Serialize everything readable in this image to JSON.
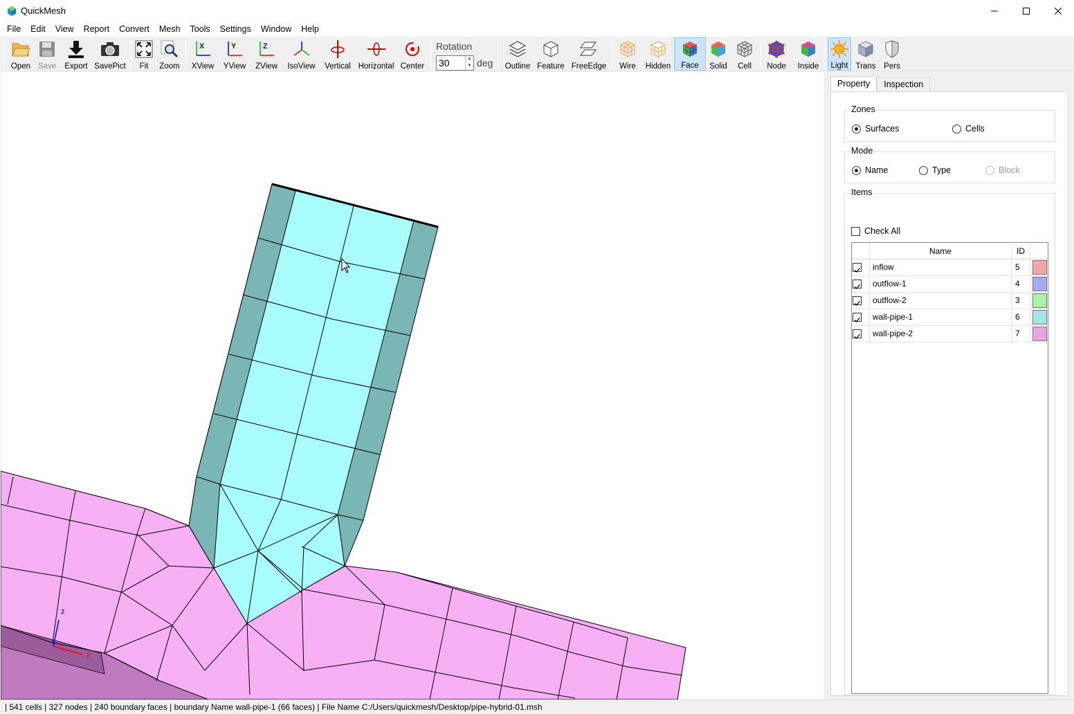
{
  "window": {
    "title": "QuickMesh"
  },
  "menu": [
    "File",
    "Edit",
    "View",
    "Report",
    "Convert",
    "Mesh",
    "Tools",
    "Settings",
    "Window",
    "Help"
  ],
  "toolbar": {
    "open": "Open",
    "save": "Save",
    "export": "Export",
    "savepict": "SavePict",
    "fit": "Fit",
    "zoom": "Zoom",
    "xview": "XView",
    "yview": "YView",
    "zview": "ZView",
    "isoview": "IsoView",
    "vertical": "Vertical",
    "horizontal": "Horizontal",
    "center": "Center",
    "rotation_label": "Rotation",
    "rotation_value": "30",
    "rotation_unit": "deg",
    "outline": "Outline",
    "feature": "Feature",
    "freeedge": "FreeEdge",
    "wire": "Wire",
    "hidden": "Hidden",
    "face": "Face",
    "solid": "Solid",
    "cell": "Cell",
    "node": "Node",
    "inside": "Inside",
    "light": "Light",
    "trans": "Trans",
    "pers": "Pers"
  },
  "panel": {
    "tabs": [
      "Property",
      "Inspection"
    ],
    "zones": {
      "title": "Zones",
      "surfaces": "Surfaces",
      "cells": "Cells"
    },
    "mode": {
      "title": "Mode",
      "name": "Name",
      "type": "Type",
      "block": "Block"
    },
    "items": {
      "title": "Items",
      "check_all": "Check All",
      "col_name": "Name",
      "col_id": "ID",
      "rows": [
        {
          "name": "inflow",
          "id": "5",
          "color": "#f4a6a6"
        },
        {
          "name": "outflow-1",
          "id": "4",
          "color": "#a7a7f4"
        },
        {
          "name": "outflow-2",
          "id": "3",
          "color": "#a7f4a7"
        },
        {
          "name": "wall-pipe-1",
          "id": "6",
          "color": "#a6e6e0"
        },
        {
          "name": "wall-pipe-2",
          "id": "7",
          "color": "#e6a6e6"
        }
      ]
    }
  },
  "axes": {
    "x": "x",
    "z": "z"
  },
  "status": "| 541 cells | 327 nodes | 240 boundary faces |   boundary Name wall-pipe-1 (66 faces) | File Name C:/Users/quickmesh/Desktop/pipe-hybrid-01.msh"
}
